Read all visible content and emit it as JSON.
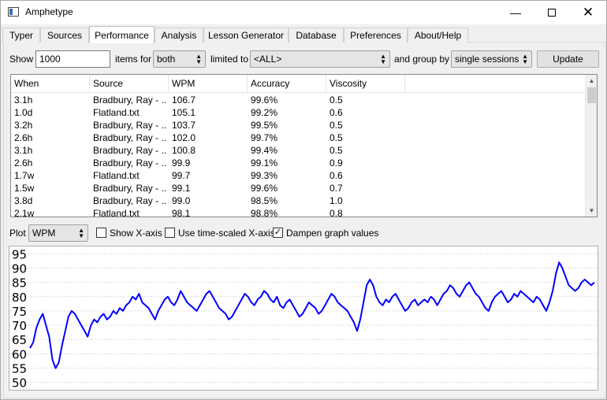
{
  "window": {
    "title": "Amphetype",
    "minimize_icon": "minimize-icon",
    "maximize_icon": "maximize-icon",
    "close_icon": "close-icon"
  },
  "tabs": [
    "Typer",
    "Sources",
    "Performance",
    "Analysis",
    "Lesson Generator",
    "Database",
    "Preferences",
    "About/Help"
  ],
  "active_tab": "Performance",
  "controls": {
    "show_label": "Show",
    "show_value": "1000",
    "items_for_label": "items for",
    "items_for_value": "both",
    "limited_to_label": "limited to",
    "limited_to_value": "<ALL>",
    "group_by_label": "and group by",
    "group_by_value": "single sessions",
    "update_button": "Update"
  },
  "table": {
    "columns": [
      "When",
      "Source",
      "WPM",
      "Accuracy",
      "Viscosity"
    ],
    "rows": [
      [
        "3.1h",
        "Bradbury, Ray - ...",
        "106.7",
        "99.6%",
        "0.5"
      ],
      [
        "1.0d",
        "Flatland.txt",
        "105.1",
        "99.2%",
        "0.6"
      ],
      [
        "3.2h",
        "Bradbury, Ray - ...",
        "103.7",
        "99.5%",
        "0.5"
      ],
      [
        "2.6h",
        "Bradbury, Ray - ...",
        "102.0",
        "99.7%",
        "0.5"
      ],
      [
        "3.1h",
        "Bradbury, Ray - ...",
        "100.8",
        "99.4%",
        "0.5"
      ],
      [
        "2.6h",
        "Bradbury, Ray - ...",
        "99.9",
        "99.1%",
        "0.9"
      ],
      [
        "1.7w",
        "Flatland.txt",
        "99.7",
        "99.3%",
        "0.6"
      ],
      [
        "1.5w",
        "Bradbury, Ray - ...",
        "99.1",
        "99.6%",
        "0.7"
      ],
      [
        "3.8d",
        "Bradbury, Ray - ...",
        "99.0",
        "98.5%",
        "1.0"
      ],
      [
        "2.1w",
        "Flatland.txt",
        "98.1",
        "98.8%",
        "0.8"
      ]
    ]
  },
  "plot_controls": {
    "plot_label": "Plot",
    "plot_value": "WPM",
    "show_x_axis_label": "Show X-axis",
    "show_x_axis_checked": false,
    "time_scaled_label": "Use time-scaled X-axis",
    "time_scaled_checked": false,
    "dampen_label": "Dampen graph values",
    "dampen_checked": true,
    "check_mark": "✓"
  },
  "chart_data": {
    "type": "line",
    "title": "",
    "xlabel": "",
    "ylabel": "",
    "y_ticks": [
      "95",
      "90",
      "85",
      "80",
      "75",
      "70",
      "65",
      "60",
      "55",
      "50"
    ],
    "ylim": [
      48,
      97
    ],
    "grid": true,
    "line_color": "#0000ff",
    "series": [
      {
        "values": [
          62,
          64,
          69,
          72,
          74,
          70,
          66,
          58,
          55,
          57,
          63,
          68,
          73,
          75,
          74,
          72,
          70,
          68,
          66,
          70,
          72,
          71,
          73,
          74,
          72,
          73,
          75,
          74,
          76,
          75,
          77,
          78,
          80,
          79,
          81,
          78,
          77,
          76,
          74,
          72,
          75,
          77,
          79,
          80,
          78,
          77,
          79,
          82,
          80,
          78,
          77,
          76,
          75,
          77,
          79,
          81,
          82,
          80,
          78,
          76,
          75,
          74,
          72,
          73,
          75,
          77,
          79,
          81,
          80,
          78,
          77,
          79,
          80,
          82,
          81,
          79,
          78,
          80,
          77,
          76,
          78,
          79,
          77,
          75,
          73,
          74,
          76,
          78,
          77,
          76,
          74,
          75,
          77,
          79,
          81,
          80,
          78,
          77,
          76,
          75,
          73,
          71,
          68,
          72,
          78,
          84,
          86,
          84,
          80,
          78,
          77,
          79,
          78,
          80,
          81,
          79,
          77,
          75,
          76,
          78,
          79,
          77,
          78,
          79,
          78,
          80,
          79,
          77,
          79,
          81,
          82,
          84,
          83,
          81,
          80,
          82,
          84,
          85,
          83,
          81,
          80,
          78,
          76,
          75,
          78,
          80,
          81,
          82,
          80,
          78,
          79,
          81,
          80,
          82,
          81,
          80,
          79,
          78,
          80,
          79,
          77,
          75,
          78,
          82,
          88,
          92,
          90,
          87,
          84,
          83,
          82,
          83,
          85,
          86,
          85,
          84,
          85
        ]
      }
    ]
  },
  "scroll_icons": {
    "up": "▲",
    "down": "▼"
  }
}
